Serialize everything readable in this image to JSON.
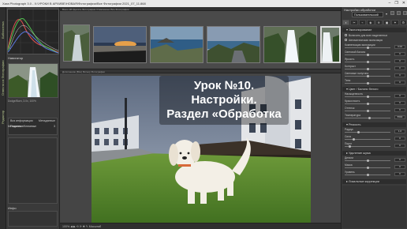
{
  "window": {
    "title": "Xara Photograph 3.0 - X:\\УРОКИ В АРХИВЕ\\НОВАЯ\\Фотографии\\Все Фотографии 2021_07_11.868",
    "controls": [
      "–",
      "❐",
      "✕"
    ]
  },
  "left_tabs": [
    "Библиотека",
    "Отвести из Фотографии",
    "Редактор"
  ],
  "left_panel": {
    "histogram_label": "Гистограмма",
    "navigator_label": "Навигатор",
    "thumb_caption": "Dodge/Burn, 3.0х, 100%",
    "info_rows": [
      {
        "label": "Вся информация",
        "value": "Метаданные"
      },
      {
        "label": "Пиксели",
        "value": "3"
      }
    ],
    "meta_label": "Метаданные/Ключевые",
    "bottom_label": "Инфо"
  },
  "filmstrip": {
    "toolbar_text": "Всего 28 Удалить Фотография Отмеченных Все Фотографии",
    "count": 6,
    "selected_index": 4
  },
  "viewer": {
    "toolbar_text": "Дополнение (Все) Фильтр Фотографии",
    "overlay_lines": [
      "Урок №10.",
      "Настройки.",
      "Раздел «Обработка"
    ],
    "bottom_text": "100% ◀ ▶ ⟲ ⟳ ✚ ✎ Масштаб"
  },
  "right_panel": {
    "title": "Настройки обработки",
    "preset": "Пользовательский",
    "tool_icons": [
      "◐",
      "✂",
      "⌁",
      "◈",
      "≋",
      "▣",
      "✦",
      "⚙"
    ],
    "sections": [
      {
        "name": "▾ Экспонирование"
      },
      {
        "name": "▾ Цвет / Баланс белого"
      },
      {
        "name": "▾ Резкость"
      },
      {
        "name": "▸ Удаление шума"
      },
      {
        "name": "▸ Локальные коррекции"
      }
    ],
    "checks": [
      "Включить для всех выделенных",
      "Автоматическая экспозиция"
    ],
    "sliders": [
      {
        "label": "Компенсация экспозиции",
        "value": "0.00",
        "pos": 0.5
      },
      {
        "label": "Световой баланс",
        "value": "0",
        "pos": 0.5
      },
      {
        "label": "Яркость",
        "value": "0",
        "pos": 0.5
      },
      {
        "label": "Контраст",
        "value": "0",
        "pos": 0.5
      },
      {
        "label": "Световые полутона",
        "value": "0",
        "pos": 0.5
      },
      {
        "label": "Тени",
        "value": "0",
        "pos": 0.5
      },
      {
        "label": "Насыщенность",
        "value": "0",
        "pos": 0.5
      },
      {
        "label": "Красочность",
        "value": "0",
        "pos": 0.5
      },
      {
        "label": "Оттенок",
        "value": "0",
        "pos": 0.5
      },
      {
        "label": "Температура",
        "value": "5500",
        "pos": 0.55
      },
      {
        "label": "Радиус",
        "value": "1.0",
        "pos": 0.3
      },
      {
        "label": "Сила",
        "value": "0",
        "pos": 0.2
      },
      {
        "label": "Порог",
        "value": "0",
        "pos": 0.1
      },
      {
        "label": "Детали",
        "value": "0",
        "pos": 0.5
      },
      {
        "label": "Маска",
        "value": "0",
        "pos": 0.5
      },
      {
        "label": "Уровень",
        "value": "0",
        "pos": 0.5
      }
    ]
  },
  "colors": {
    "panel_bg": "#3b3b3b",
    "accent": "#b7c88d",
    "titlebar": "#e9e9e9"
  }
}
